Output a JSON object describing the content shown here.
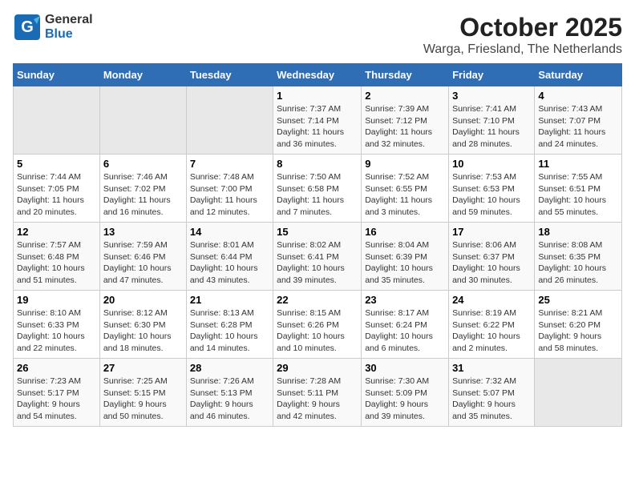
{
  "header": {
    "logo_general": "General",
    "logo_blue": "Blue",
    "title": "October 2025",
    "subtitle": "Warga, Friesland, The Netherlands"
  },
  "days_of_week": [
    "Sunday",
    "Monday",
    "Tuesday",
    "Wednesday",
    "Thursday",
    "Friday",
    "Saturday"
  ],
  "weeks": [
    [
      {
        "day": "",
        "info": ""
      },
      {
        "day": "",
        "info": ""
      },
      {
        "day": "",
        "info": ""
      },
      {
        "day": "1",
        "info": "Sunrise: 7:37 AM\nSunset: 7:14 PM\nDaylight: 11 hours\nand 36 minutes."
      },
      {
        "day": "2",
        "info": "Sunrise: 7:39 AM\nSunset: 7:12 PM\nDaylight: 11 hours\nand 32 minutes."
      },
      {
        "day": "3",
        "info": "Sunrise: 7:41 AM\nSunset: 7:10 PM\nDaylight: 11 hours\nand 28 minutes."
      },
      {
        "day": "4",
        "info": "Sunrise: 7:43 AM\nSunset: 7:07 PM\nDaylight: 11 hours\nand 24 minutes."
      }
    ],
    [
      {
        "day": "5",
        "info": "Sunrise: 7:44 AM\nSunset: 7:05 PM\nDaylight: 11 hours\nand 20 minutes."
      },
      {
        "day": "6",
        "info": "Sunrise: 7:46 AM\nSunset: 7:02 PM\nDaylight: 11 hours\nand 16 minutes."
      },
      {
        "day": "7",
        "info": "Sunrise: 7:48 AM\nSunset: 7:00 PM\nDaylight: 11 hours\nand 12 minutes."
      },
      {
        "day": "8",
        "info": "Sunrise: 7:50 AM\nSunset: 6:58 PM\nDaylight: 11 hours\nand 7 minutes."
      },
      {
        "day": "9",
        "info": "Sunrise: 7:52 AM\nSunset: 6:55 PM\nDaylight: 11 hours\nand 3 minutes."
      },
      {
        "day": "10",
        "info": "Sunrise: 7:53 AM\nSunset: 6:53 PM\nDaylight: 10 hours\nand 59 minutes."
      },
      {
        "day": "11",
        "info": "Sunrise: 7:55 AM\nSunset: 6:51 PM\nDaylight: 10 hours\nand 55 minutes."
      }
    ],
    [
      {
        "day": "12",
        "info": "Sunrise: 7:57 AM\nSunset: 6:48 PM\nDaylight: 10 hours\nand 51 minutes."
      },
      {
        "day": "13",
        "info": "Sunrise: 7:59 AM\nSunset: 6:46 PM\nDaylight: 10 hours\nand 47 minutes."
      },
      {
        "day": "14",
        "info": "Sunrise: 8:01 AM\nSunset: 6:44 PM\nDaylight: 10 hours\nand 43 minutes."
      },
      {
        "day": "15",
        "info": "Sunrise: 8:02 AM\nSunset: 6:41 PM\nDaylight: 10 hours\nand 39 minutes."
      },
      {
        "day": "16",
        "info": "Sunrise: 8:04 AM\nSunset: 6:39 PM\nDaylight: 10 hours\nand 35 minutes."
      },
      {
        "day": "17",
        "info": "Sunrise: 8:06 AM\nSunset: 6:37 PM\nDaylight: 10 hours\nand 30 minutes."
      },
      {
        "day": "18",
        "info": "Sunrise: 8:08 AM\nSunset: 6:35 PM\nDaylight: 10 hours\nand 26 minutes."
      }
    ],
    [
      {
        "day": "19",
        "info": "Sunrise: 8:10 AM\nSunset: 6:33 PM\nDaylight: 10 hours\nand 22 minutes."
      },
      {
        "day": "20",
        "info": "Sunrise: 8:12 AM\nSunset: 6:30 PM\nDaylight: 10 hours\nand 18 minutes."
      },
      {
        "day": "21",
        "info": "Sunrise: 8:13 AM\nSunset: 6:28 PM\nDaylight: 10 hours\nand 14 minutes."
      },
      {
        "day": "22",
        "info": "Sunrise: 8:15 AM\nSunset: 6:26 PM\nDaylight: 10 hours\nand 10 minutes."
      },
      {
        "day": "23",
        "info": "Sunrise: 8:17 AM\nSunset: 6:24 PM\nDaylight: 10 hours\nand 6 minutes."
      },
      {
        "day": "24",
        "info": "Sunrise: 8:19 AM\nSunset: 6:22 PM\nDaylight: 10 hours\nand 2 minutes."
      },
      {
        "day": "25",
        "info": "Sunrise: 8:21 AM\nSunset: 6:20 PM\nDaylight: 9 hours\nand 58 minutes."
      }
    ],
    [
      {
        "day": "26",
        "info": "Sunrise: 7:23 AM\nSunset: 5:17 PM\nDaylight: 9 hours\nand 54 minutes."
      },
      {
        "day": "27",
        "info": "Sunrise: 7:25 AM\nSunset: 5:15 PM\nDaylight: 9 hours\nand 50 minutes."
      },
      {
        "day": "28",
        "info": "Sunrise: 7:26 AM\nSunset: 5:13 PM\nDaylight: 9 hours\nand 46 minutes."
      },
      {
        "day": "29",
        "info": "Sunrise: 7:28 AM\nSunset: 5:11 PM\nDaylight: 9 hours\nand 42 minutes."
      },
      {
        "day": "30",
        "info": "Sunrise: 7:30 AM\nSunset: 5:09 PM\nDaylight: 9 hours\nand 39 minutes."
      },
      {
        "day": "31",
        "info": "Sunrise: 7:32 AM\nSunset: 5:07 PM\nDaylight: 9 hours\nand 35 minutes."
      },
      {
        "day": "",
        "info": ""
      }
    ]
  ]
}
